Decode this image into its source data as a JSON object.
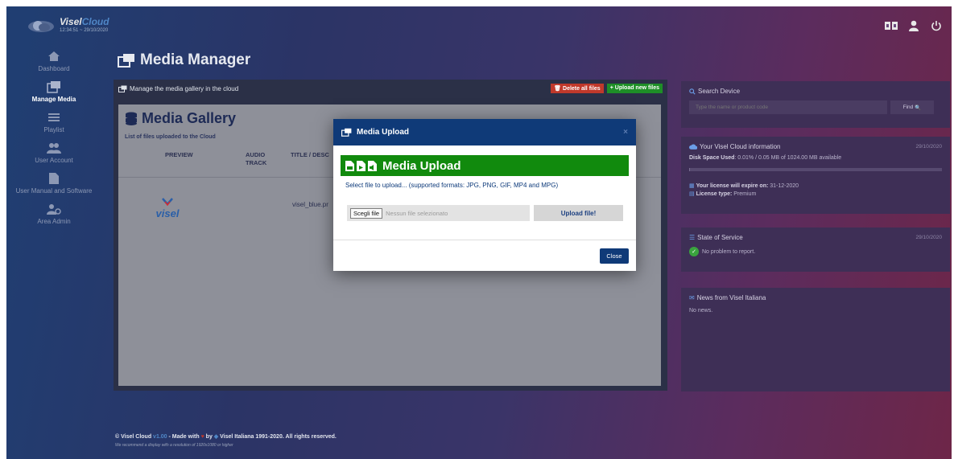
{
  "header": {
    "brand_part1": "Visel",
    "brand_part2": "Cloud",
    "clock": "12:34:51 ~ 29/10/2020"
  },
  "sidebar": {
    "items": [
      {
        "label": "Dashboard",
        "icon": "home-icon"
      },
      {
        "label": "Manage Media",
        "icon": "media-icon"
      },
      {
        "label": "Playlist",
        "icon": "playlist-icon"
      },
      {
        "label": "User Account",
        "icon": "users-icon"
      },
      {
        "label": "User Manual and Software",
        "icon": "document-icon"
      },
      {
        "label": "Area Admin",
        "icon": "admin-icon"
      }
    ],
    "active_index": 1
  },
  "page": {
    "title": "Media Manager"
  },
  "main": {
    "header": "Manage the media gallery in the cloud",
    "delete_all": "Delete all files",
    "upload_new": "Upload new files",
    "gallery_title": "Media Gallery",
    "gallery_sub": "List of files uploaded to the Cloud",
    "columns": [
      "PREVIEW",
      "AUDIO TRACK",
      "TITLE / DESC"
    ],
    "rows": [
      {
        "preview": "visel-logo",
        "file": "visel_blue.pr"
      }
    ]
  },
  "right": {
    "search_title": "Search Device",
    "search_placeholder": "Type the name or product code",
    "find": "Find",
    "info_title": "Your Visel Cloud information",
    "info_date": "29/10/2020",
    "disk_label": "Disk Space Used",
    "disk_value": ": 0.01% / 0.05 MB of 1024.00 MB available",
    "disk_fraction": 0.0001,
    "license_expire_label": "Your license will expire on:",
    "license_expire": "31-12-2020",
    "license_type_label": "License type:",
    "license_type": "Premium",
    "state_title": "State of Service",
    "state_date": "29/10/2020",
    "state_message": "No problem to report.",
    "news_title": "News from Visel Italiana",
    "news_body": "No news."
  },
  "footer": {
    "part1": "© Visel Cloud ",
    "version": "v1.00",
    "part2": " - Made with ",
    "heart": "♥",
    "part3": " by ",
    "part4": " Visel Italiana 1991-2020. All rights reserved.",
    "sub": "We recommend a display with a resolution of 1920x1080 or higher"
  },
  "modal": {
    "title": "Media Upload",
    "banner": "Media Upload",
    "hint": "Select file to upload... (supported formats: JPG, PNG, GIF, MP4 and MPG)",
    "choose": "Scegli file",
    "no_file": "Nessun file selezionato",
    "upload": "Upload file!",
    "close": "Close",
    "close_x": "×"
  },
  "colors": {
    "modal_header": "#0f3a78",
    "banner": "#118a0d",
    "delete": "#c0392b",
    "upload": "#1e8f27",
    "accent": "#4f86c6"
  }
}
